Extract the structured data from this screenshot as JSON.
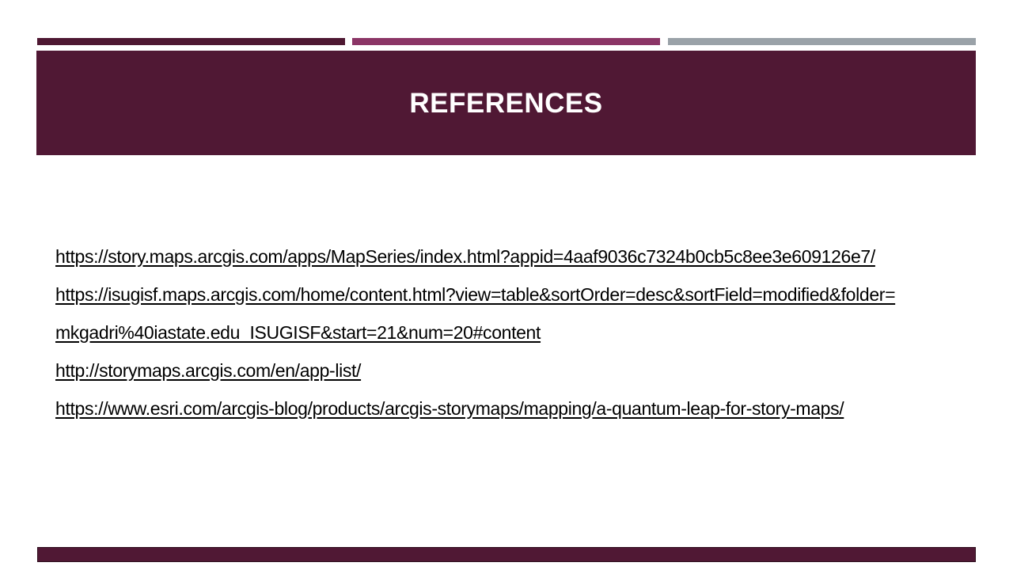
{
  "slide": {
    "title": "REFERENCES",
    "references": [
      "https://story.maps.arcgis.com/apps/MapSeries/index.html?appid=4aaf9036c7324b0cb5c8ee3e609126e7/",
      "https://isugisf.maps.arcgis.com/home/content.html?view=table&sortOrder=desc&sortField=modified&folder=",
      "mkgadri%40iastate.edu_ISUGISF&start=21&num=20#content",
      "http://storymaps.arcgis.com/en/app-list/",
      "https://www.esri.com/arcgis-blog/products/arcgis-storymaps/mapping/a-quantum-leap-for-story-maps/"
    ]
  },
  "colors": {
    "title_band": "#501834",
    "accent_dark": "#4e1832",
    "accent_magenta": "#8b3566",
    "accent_gray": "#9aa2a8",
    "text": "#000000"
  }
}
